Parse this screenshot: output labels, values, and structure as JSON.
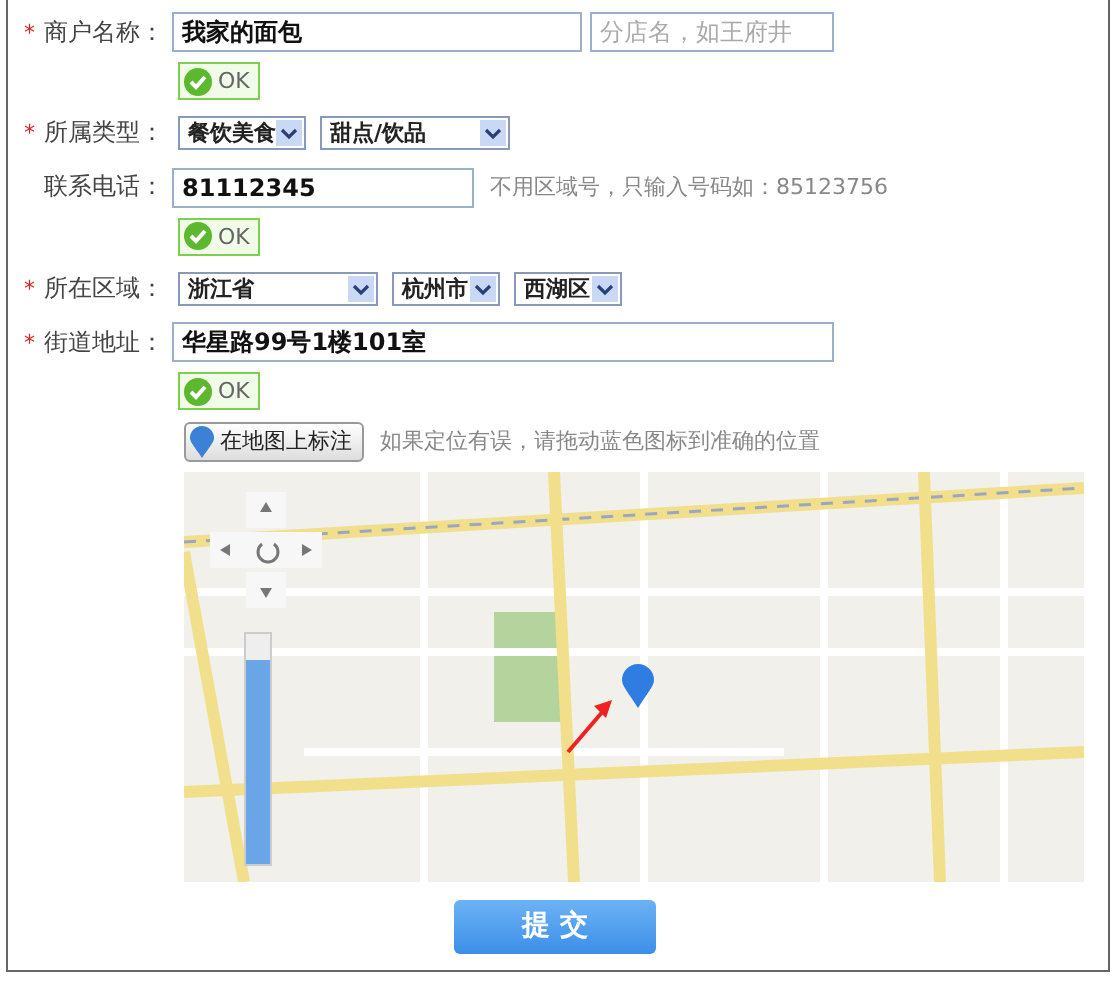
{
  "required_mark": "*",
  "fields": [
    {
      "label": "商户名称：",
      "required": true,
      "kind": "text",
      "inputs": [
        {
          "value": "我家的面包"
        },
        {
          "placeholder": "分店名，如王府井"
        }
      ],
      "ok": "OK"
    },
    {
      "label": "所属类型：",
      "required": true,
      "kind": "select",
      "selects": [
        "餐饮美食",
        "甜点/饮品"
      ]
    },
    {
      "label": "联系电话：",
      "required": false,
      "kind": "text",
      "inputs": [
        {
          "value": "81112345"
        }
      ],
      "hint": "不用区域号，只输入号码如：85123756",
      "ok": "OK"
    },
    {
      "label": "所在区域：",
      "required": true,
      "kind": "select",
      "selects": [
        "浙江省",
        "杭州市",
        "西湖区"
      ]
    },
    {
      "label": "街道地址：",
      "required": true,
      "kind": "text",
      "inputs": [
        {
          "value": "华星路99号1楼101室"
        }
      ],
      "ok": "OK"
    }
  ],
  "map": {
    "button": "在地图上标注",
    "hint": "如果定位有误，请拖动蓝色图标到准确的位置",
    "zoom": {
      "level": 0.88
    }
  },
  "submit": "提 交"
}
